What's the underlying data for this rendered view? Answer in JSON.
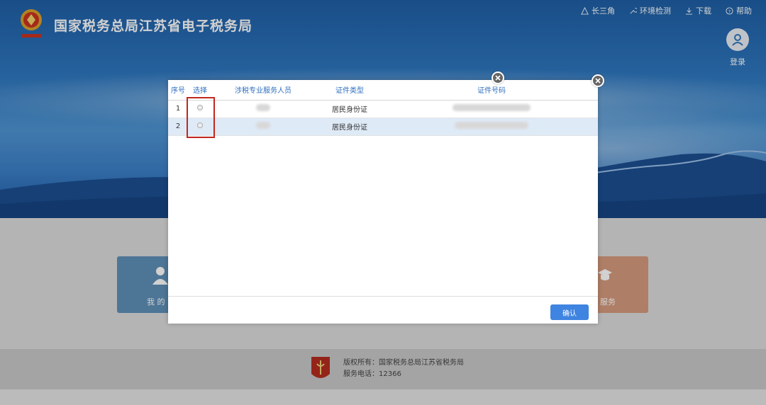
{
  "header": {
    "site_title": "国家税务总局江苏省电子税务局",
    "links": [
      {
        "label": "长三角",
        "icon": "triangle-icon"
      },
      {
        "label": "环境检测",
        "icon": "wrench-icon"
      },
      {
        "label": "下载",
        "icon": "download-icon"
      },
      {
        "label": "帮助",
        "icon": "help-icon"
      }
    ],
    "login_label": "登录"
  },
  "tiles": {
    "left_label": "我 的 ",
    "right_label": "服务"
  },
  "dialog": {
    "columns": [
      "序号",
      "选择",
      "涉税专业服务人员",
      "证件类型",
      "证件号码"
    ],
    "rows": [
      {
        "no": "1",
        "type": "居民身份证"
      },
      {
        "no": "2",
        "type": "居民身份证"
      }
    ],
    "confirm_label": "确认"
  },
  "footer": {
    "copyright": "版权所有：国家税务总局江苏省税务局",
    "phone": "服务电话：12366"
  },
  "colors": {
    "accent": "#2f6fc0",
    "button": "#3f84e0",
    "highlight": "#c0281e",
    "selected_row": "#dfeaf7"
  }
}
